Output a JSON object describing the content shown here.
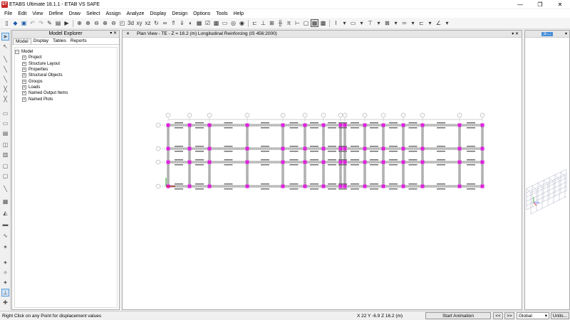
{
  "window": {
    "app_icon": "ET",
    "title": "ETABS Ultimate 18.1.1 - ETAB VS SAFE",
    "minimize": "—",
    "restore": "❐",
    "close": "✕"
  },
  "menu": [
    "File",
    "Edit",
    "View",
    "Define",
    "Draw",
    "Select",
    "Assign",
    "Analyze",
    "Display",
    "Design",
    "Options",
    "Tools",
    "Help"
  ],
  "explorer": {
    "title": "Model Explorer",
    "header_controls": "▾ ✕",
    "tabs": [
      "Model",
      "Display",
      "Tables",
      "Reports"
    ],
    "root": "Model",
    "items": [
      "Project",
      "Structure Layout",
      "Properties",
      "Structural Objects",
      "Groups",
      "Loads",
      "Named Output Items",
      "Named Plots"
    ]
  },
  "plan_view": {
    "title": "Plan View - TE - Z = 16.2 (m)  Longitudinal Reinforcing  (IS 456:2000)",
    "close": "✕",
    "controls": "▾ ✕"
  },
  "view3d": {
    "tab_label": "3-...",
    "controls": "▾"
  },
  "statusbar": {
    "message": "Right Click on any Point for displacement values",
    "coords": "X 22  Y -6.9  Z 16.2 (m)",
    "start_animation": "Start Animation",
    "prev": "<<",
    ">>": ">>",
    "coord_system": "Global",
    "units": "Units..."
  },
  "colors": {
    "beam": "#303030",
    "column": "#e020e0",
    "grid": "#8a8a8a",
    "accent": "#1e5aa8"
  }
}
